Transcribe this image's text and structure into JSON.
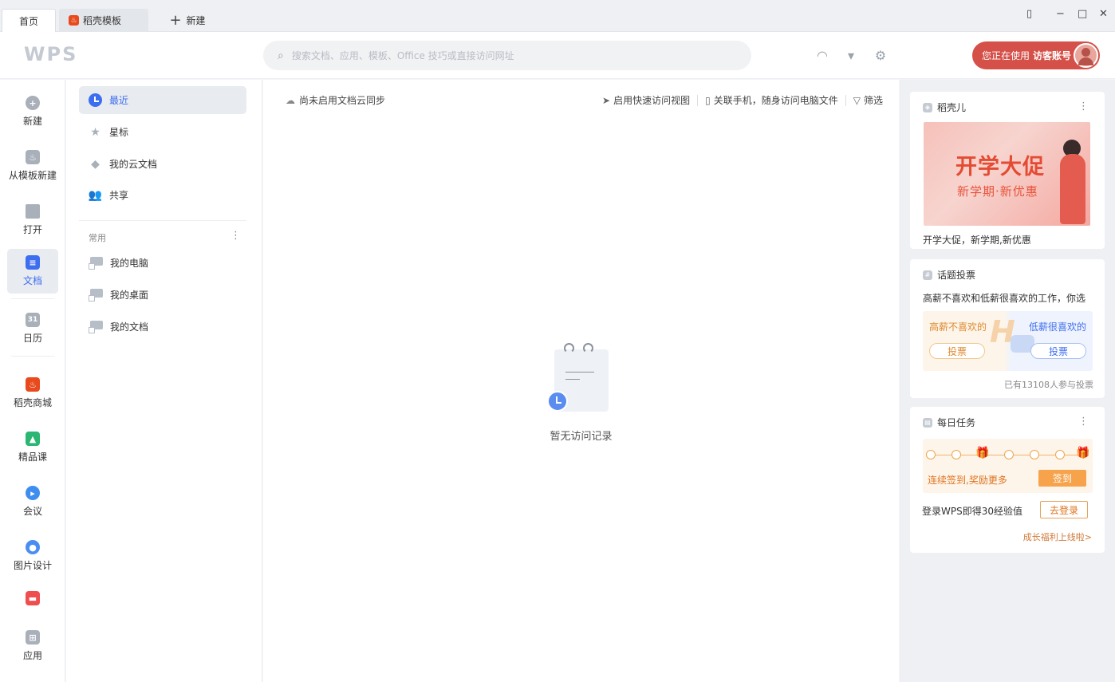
{
  "tabs": [
    {
      "label": "首页"
    },
    {
      "label": "稻壳模板"
    },
    {
      "label": "新建"
    }
  ],
  "header": {
    "logo": "WPS",
    "search_placeholder": "搜索文档、应用、模板、Office 技巧或直接访问网址",
    "account_prefix": "您正在使用",
    "account_name": "访客账号"
  },
  "leftnav": [
    {
      "label": "新建"
    },
    {
      "label": "从模板新建"
    },
    {
      "label": "打开"
    },
    {
      "label": "文档"
    },
    {
      "label": "日历"
    },
    {
      "label": "稻壳商城"
    },
    {
      "label": "精品课"
    },
    {
      "label": "会议"
    },
    {
      "label": "图片设计"
    },
    {
      "label": "应用"
    }
  ],
  "secnav": {
    "items": [
      {
        "label": "最近"
      },
      {
        "label": "星标"
      },
      {
        "label": "我的云文档"
      },
      {
        "label": "共享"
      }
    ],
    "section_title": "常用",
    "common": [
      {
        "label": "我的电脑"
      },
      {
        "label": "我的桌面"
      },
      {
        "label": "我的文档"
      }
    ]
  },
  "main": {
    "sync_note": "尚未启用文档云同步",
    "links": [
      "启用快速访问视图",
      "关联手机，随身访问电脑文件",
      "筛选"
    ],
    "empty_text": "暂无访问记录"
  },
  "cards": {
    "docer": {
      "title": "稻壳儿",
      "banner_big": "开学大促",
      "banner_small": "新学期·新优惠",
      "caption": "开学大促，新学期,新优惠"
    },
    "poll": {
      "title": "话题投票",
      "question": "高薪不喜欢和低薪很喜欢的工作，你选",
      "option_left": "高薪不喜欢的",
      "option_right": "低薪很喜欢的",
      "vote_label": "投票",
      "count": "已有13108人参与投票"
    },
    "task": {
      "title": "每日任务",
      "tip": "连续签到,奖励更多",
      "sign_label": "签到",
      "text": "登录WPS即得30经验值",
      "login_label": "去登录",
      "growth": "成长福利上线啦>"
    }
  }
}
